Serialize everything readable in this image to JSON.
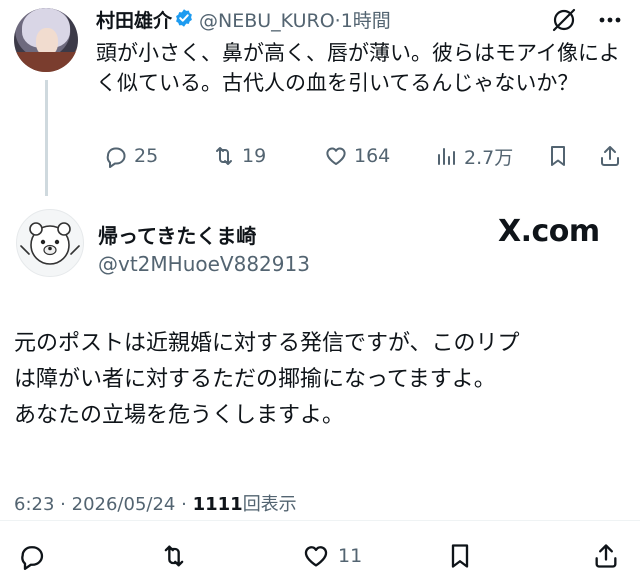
{
  "reply_context": {
    "author_name": "村田雄介",
    "handle": "@NEBU_KURO",
    "separator": "·",
    "time": "1時間",
    "text": "頭が小さく、鼻が高く、唇が薄い。彼らはモアイ像によく似ている。古代人の血を引いてるんじゃないか？",
    "stats": {
      "replies": "25",
      "reposts": "19",
      "likes": "164",
      "views": "2.7万"
    }
  },
  "main_post": {
    "author_name": "帰ってきたくま崎",
    "handle": "@vt2MHuoeV882913",
    "source_badge": "X.com",
    "text_lines": [
      "元のポストは近親婚に対する発信ですが、このリプ",
      "は障がい者に対するただの揶揄になってますよ。",
      "あなたの立場を危うくしますよ。"
    ],
    "time": "6:23",
    "date_separator": "·",
    "date": "2026/05/24",
    "meta_separator": "·",
    "views_count": "1111",
    "views_label": "回表示",
    "likes": "11"
  },
  "colors": {
    "text": "#0f1419",
    "muted": "#536471",
    "verified": "#1d9bf0",
    "thread_line": "#cfd9de"
  },
  "icons": [
    "verified-badge-icon",
    "grok-icon",
    "more-icon",
    "reply-icon",
    "repost-icon",
    "like-icon",
    "views-icon",
    "bookmark-icon",
    "share-icon"
  ]
}
